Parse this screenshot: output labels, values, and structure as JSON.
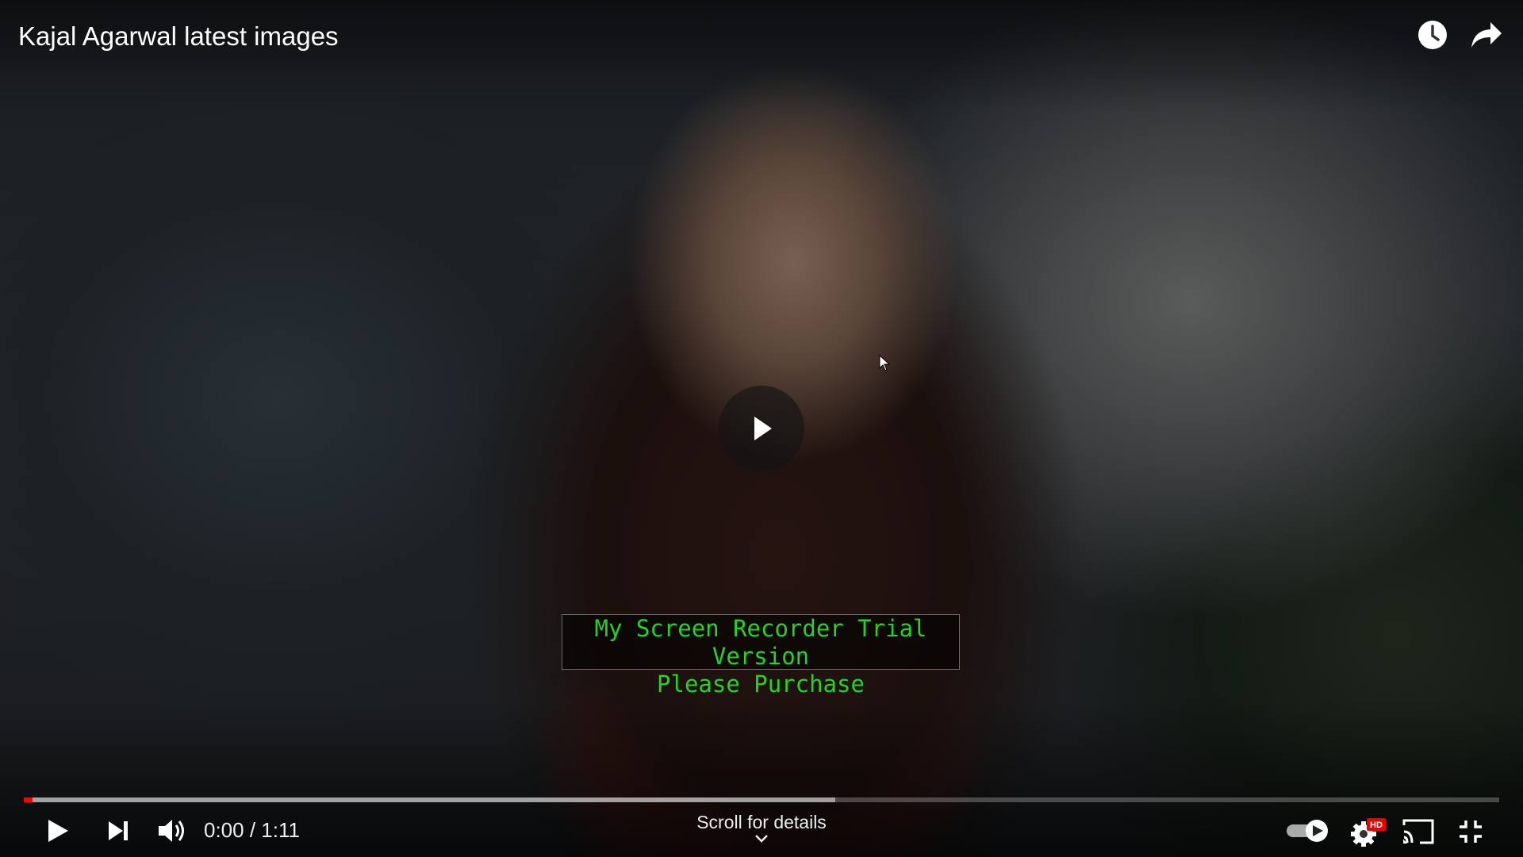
{
  "video": {
    "title": "Kajal Agarwal latest images",
    "watermark_line1": "My Screen Recorder Trial Version",
    "watermark_line2": "Please Purchase"
  },
  "top_actions": [
    {
      "name": "watch-later",
      "icon": "clock-icon"
    },
    {
      "name": "share",
      "icon": "share-arrow-icon"
    }
  ],
  "controls": {
    "time": "0:00 / 1:11",
    "scroll_label": "Scroll for details",
    "progress_played": 0.0,
    "progress_buffered": 0.55,
    "autoplay": true,
    "quality_badge": "HD",
    "accent_color": "#ff0000"
  }
}
